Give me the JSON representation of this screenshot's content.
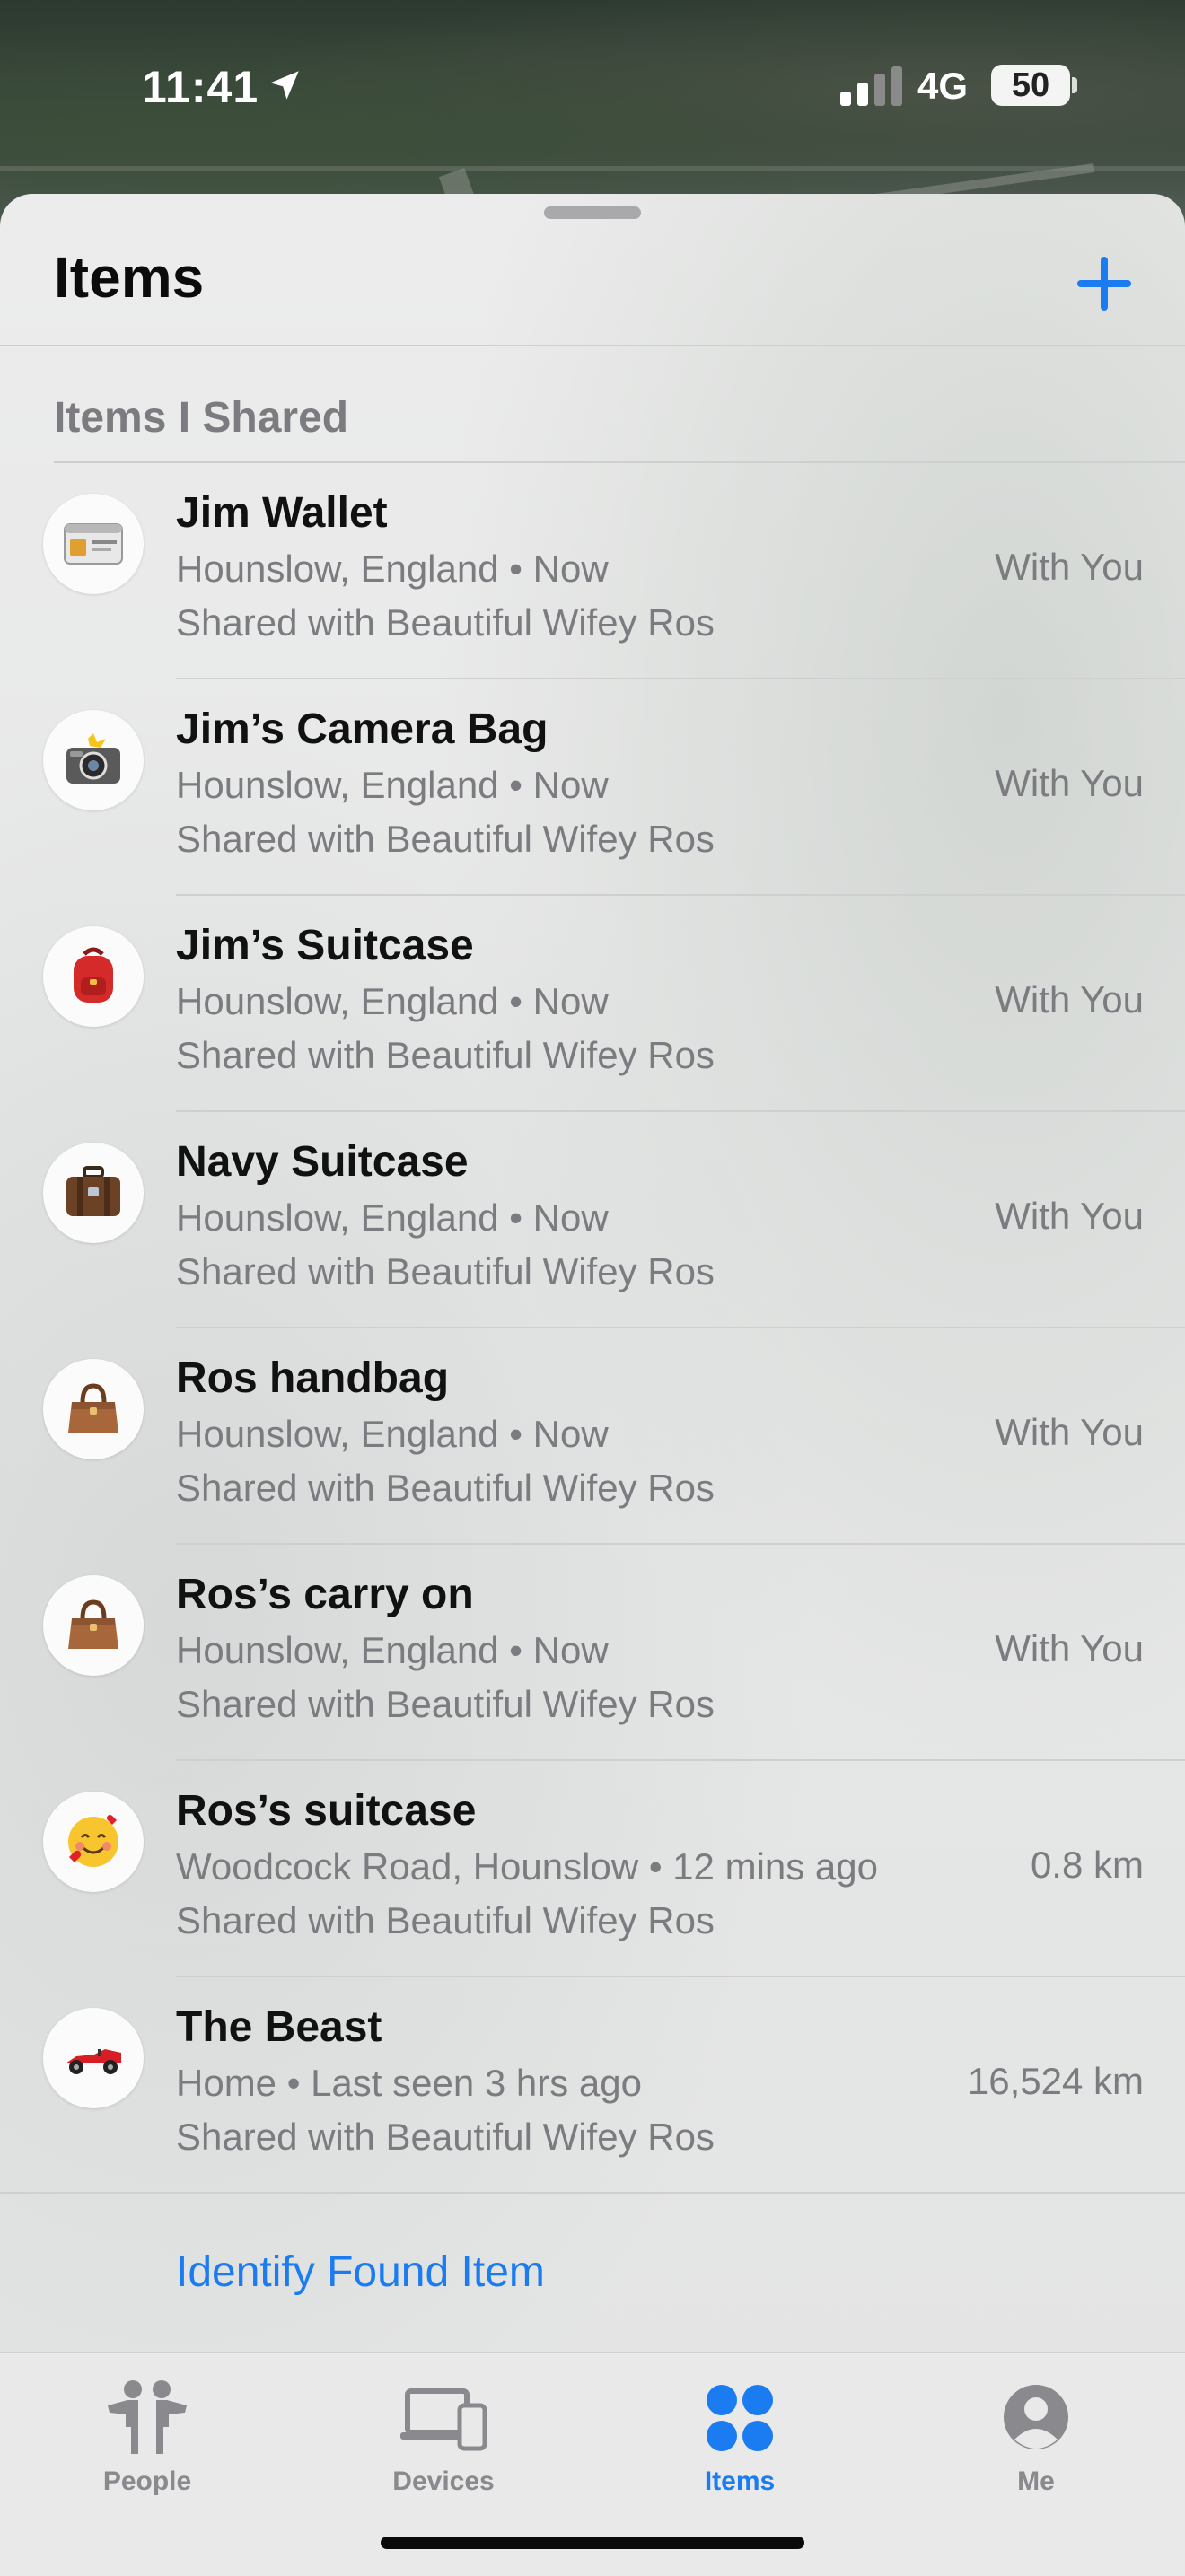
{
  "status": {
    "time": "11:41",
    "network": "4G",
    "battery": "50"
  },
  "header": {
    "title": "Items",
    "add_icon": "plus-icon"
  },
  "section": {
    "title": "Items I Shared"
  },
  "items": [
    {
      "name": "Jim Wallet",
      "location": "Hounslow, England • Now",
      "shared": "Shared with Beautiful Wifey Ros",
      "distance": "With You",
      "emoji": "🪪"
    },
    {
      "name": "Jim’s Camera Bag",
      "location": "Hounslow, England • Now",
      "shared": "Shared with Beautiful Wifey Ros",
      "distance": "With You",
      "emoji": "📸"
    },
    {
      "name": "Jim’s Suitcase",
      "location": "Hounslow, England • Now",
      "shared": "Shared with Beautiful Wifey Ros",
      "distance": "With You",
      "emoji": "🎒"
    },
    {
      "name": "Navy Suitcase",
      "location": "Hounslow, England • Now",
      "shared": "Shared with Beautiful Wifey Ros",
      "distance": "With You",
      "emoji": "🧳"
    },
    {
      "name": "Ros handbag",
      "location": "Hounslow, England • Now",
      "shared": "Shared with Beautiful Wifey Ros",
      "distance": "With You",
      "emoji": "👜"
    },
    {
      "name": "Ros’s carry on",
      "location": "Hounslow, England • Now",
      "shared": "Shared with Beautiful Wifey Ros",
      "distance": "With You",
      "emoji": "👜"
    },
    {
      "name": "Ros’s suitcase",
      "location": "Woodcock Road, Hounslow • 12 mins ago",
      "shared": "Shared with Beautiful Wifey Ros",
      "distance": "0.8 km",
      "emoji": "🥰"
    },
    {
      "name": "The Beast",
      "location": "Home • Last seen 3 hrs ago",
      "shared": "Shared with Beautiful Wifey Ros",
      "distance": "16,524 km",
      "emoji": "🏎️"
    }
  ],
  "identify": {
    "label": "Identify Found Item"
  },
  "tabs": [
    {
      "label": "People",
      "icon": "people-icon"
    },
    {
      "label": "Devices",
      "icon": "devices-icon"
    },
    {
      "label": "Items",
      "icon": "items-icon",
      "active": true
    },
    {
      "label": "Me",
      "icon": "me-icon"
    }
  ],
  "colors": {
    "accent": "#1a7cf0",
    "secondary_text": "#7b7b80"
  }
}
